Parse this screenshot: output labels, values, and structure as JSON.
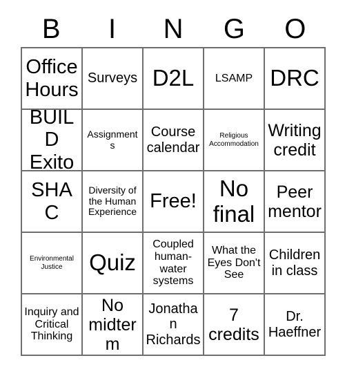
{
  "card": {
    "header_letters": [
      "B",
      "I",
      "N",
      "G",
      "O"
    ],
    "free_space_text": "Free!",
    "rows": [
      [
        {
          "text": "Office Hours",
          "size": "xl"
        },
        {
          "text": "Surveys",
          "size": "md"
        },
        {
          "text": "D2L",
          "size": "xxl"
        },
        {
          "text": "LSAMP",
          "size": "sm"
        },
        {
          "text": "DRC",
          "size": "xxl"
        }
      ],
      [
        {
          "text": "BUILD Exito",
          "size": "xl"
        },
        {
          "text": "Assignments",
          "size": "xs"
        },
        {
          "text": "Course calendar",
          "size": "md"
        },
        {
          "text": "Religious Accommodation",
          "size": "xxs"
        },
        {
          "text": "Writing credit",
          "size": "lg"
        }
      ],
      [
        {
          "text": "SHAC",
          "size": "xl"
        },
        {
          "text": "Diversity of the Human Experience",
          "size": "xs"
        },
        {
          "text": "Free!",
          "size": "xl"
        },
        {
          "text": "No final",
          "size": "xxl"
        },
        {
          "text": "Peer mentor",
          "size": "lg"
        }
      ],
      [
        {
          "text": "Environmental Justice",
          "size": "xxs"
        },
        {
          "text": "Quiz",
          "size": "xxl"
        },
        {
          "text": "Coupled human-water systems",
          "size": "sm"
        },
        {
          "text": "What the Eyes Don't See",
          "size": "sm"
        },
        {
          "text": "Children in class",
          "size": "md"
        }
      ],
      [
        {
          "text": "Inquiry and Critical Thinking",
          "size": "sm"
        },
        {
          "text": "No midterm",
          "size": "lg"
        },
        {
          "text": "Jonathan Richards",
          "size": "md"
        },
        {
          "text": "7 credits",
          "size": "lg"
        },
        {
          "text": "Dr. Haeffner",
          "size": "md"
        }
      ]
    ]
  },
  "colors": {
    "grid_line": "#6e6e6e",
    "text": "#000000",
    "background": "#ffffff"
  }
}
